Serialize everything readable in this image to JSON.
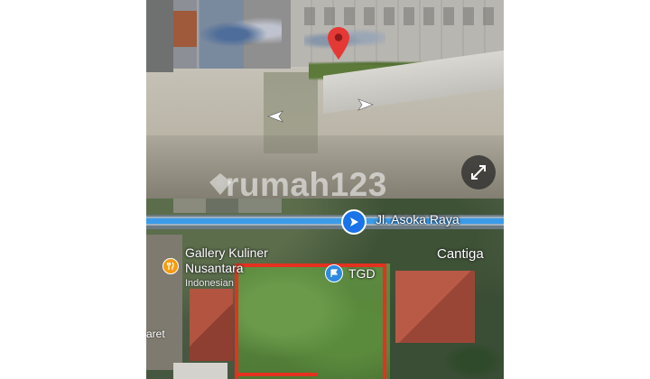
{
  "street_view": {
    "pin_icon": "map-pin-icon",
    "nav_left_icon": "chevron-left-icon",
    "nav_right_icon": "chevron-right-icon",
    "expand_icon": "expand-arrows-icon",
    "colors": {
      "pin": "#e53935",
      "expand_bg": "#2b2b2b"
    }
  },
  "watermark": {
    "text": "rumah123",
    "icon": "rumah123-logo-icon"
  },
  "map": {
    "road_label": "Jl. Asoka Raya",
    "road_icon": "navigation-arrow-icon",
    "area_label": "Cantiga",
    "poi_gallery": {
      "name_line1": "Gallery Kuliner",
      "name_line2": "Nusantara",
      "category": "Indonesian",
      "icon": "fork-knife-icon"
    },
    "poi_tgd": {
      "name": "TGD",
      "icon": "flag-icon"
    },
    "partial_label": "aret",
    "colors": {
      "route": "#3a9ce8",
      "plot_outline": "#e5311f",
      "poi_orange": "#f39c12",
      "poi_blue": "#2e8ade"
    }
  }
}
